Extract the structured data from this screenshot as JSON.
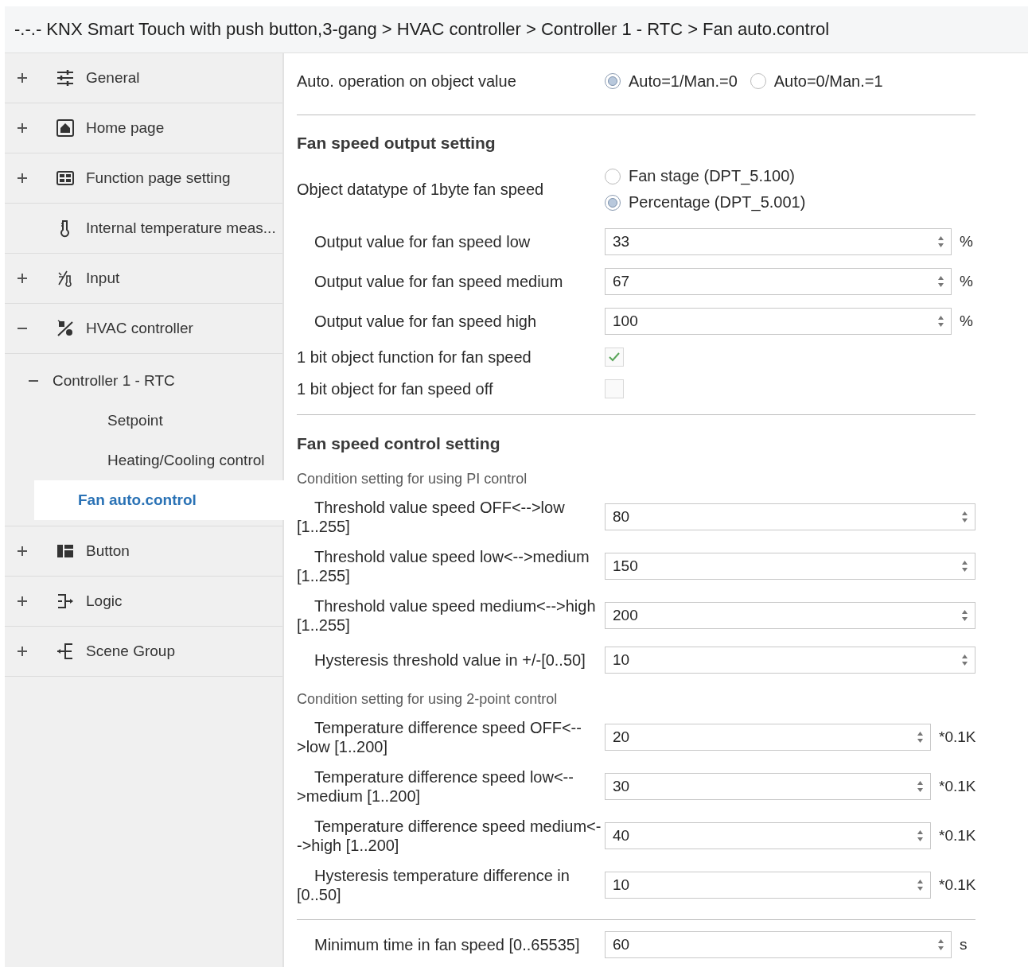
{
  "title": "-.-.- KNX Smart Touch with push button,3-gang > HVAC controller > Controller 1 - RTC > Fan auto.control",
  "sidebar": {
    "items": [
      {
        "label": "General",
        "kind": "group",
        "expanded": false,
        "selected": false
      },
      {
        "label": "Home page",
        "kind": "group",
        "expanded": false,
        "selected": false
      },
      {
        "label": "Function page setting",
        "kind": "group",
        "expanded": false,
        "selected": false
      },
      {
        "label": "Internal temperature meas...",
        "kind": "leaf",
        "selected": false
      },
      {
        "label": "Input",
        "kind": "group",
        "expanded": false,
        "selected": false
      },
      {
        "label": "HVAC controller",
        "kind": "group",
        "expanded": true,
        "selected": false,
        "children": [
          {
            "label": "Controller 1 - RTC",
            "kind": "group",
            "expanded": true,
            "selected": false,
            "children": [
              {
                "label": "Setpoint",
                "kind": "leaf",
                "selected": false
              },
              {
                "label": "Heating/Cooling control",
                "kind": "leaf",
                "selected": false
              },
              {
                "label": "Fan auto.control",
                "kind": "leaf",
                "selected": true
              }
            ]
          }
        ]
      },
      {
        "label": "Button",
        "kind": "group",
        "expanded": false,
        "selected": false
      },
      {
        "label": "Logic",
        "kind": "group",
        "expanded": false,
        "selected": false
      },
      {
        "label": "Scene Group",
        "kind": "group",
        "expanded": false,
        "selected": false
      }
    ]
  },
  "parameters": [
    {
      "kind": "inline",
      "label": "Auto. operation on object value",
      "options": [
        {
          "label": "Auto=1/Man.=0",
          "selected": true
        },
        {
          "label": "Auto=0/Man.=1",
          "selected": false
        }
      ]
    },
    {
      "kind": "divider"
    },
    {
      "kind": "heading",
      "label": "Fan speed output setting"
    },
    {
      "kind": "radio",
      "label": "Object datatype of 1byte fan speed",
      "options": [
        {
          "label": "Fan stage (DPT_5.100)",
          "selected": false
        },
        {
          "label": "Percentage (DPT_5.001)",
          "selected": true
        }
      ]
    },
    {
      "kind": "number",
      "label": "Output value for fan speed low",
      "value": "33",
      "unit": "%"
    },
    {
      "kind": "number",
      "label": "Output value for fan speed medium",
      "value": "67",
      "unit": "%"
    },
    {
      "kind": "number",
      "label": "Output value for fan speed high",
      "value": "100",
      "unit": "%"
    },
    {
      "kind": "checkbox",
      "label": "1 bit object function for fan speed",
      "checked": true
    },
    {
      "kind": "checkbox",
      "label": "1 bit object for fan speed off",
      "checked": false
    },
    {
      "kind": "divider"
    },
    {
      "kind": "heading",
      "label": "Fan speed control setting"
    },
    {
      "kind": "note",
      "label": "Condition setting for using PI control"
    },
    {
      "kind": "number",
      "label": "Threshold value speed OFF<-->low [1..255]",
      "value": "80"
    },
    {
      "kind": "number",
      "label": "Threshold value speed low<-->medium [1..255]",
      "value": "150"
    },
    {
      "kind": "number",
      "label": "Threshold value speed medium<-->high [1..255]",
      "value": "200"
    },
    {
      "kind": "number",
      "label": "Hysteresis threshold value in +/-[0..50]",
      "value": "10"
    },
    {
      "kind": "note",
      "label": "Condition setting for using 2-point control"
    },
    {
      "kind": "number",
      "label": "Temperature difference speed OFF<-->low [1..200]",
      "value": "20",
      "unit": "*0.1K"
    },
    {
      "kind": "number",
      "label": "Temperature difference speed low<-->medium [1..200]",
      "value": "30",
      "unit": "*0.1K"
    },
    {
      "kind": "number",
      "label": "Temperature difference speed medium<-->high [1..200]",
      "value": "40",
      "unit": "*0.1K"
    },
    {
      "kind": "number",
      "label": "Hysteresis temperature difference in [0..50]",
      "value": "10",
      "unit": "*0.1K"
    },
    {
      "kind": "divider"
    },
    {
      "kind": "number",
      "label": "Minimum time in fan speed [0..65535]",
      "value": "60",
      "unit": "s"
    }
  ]
}
